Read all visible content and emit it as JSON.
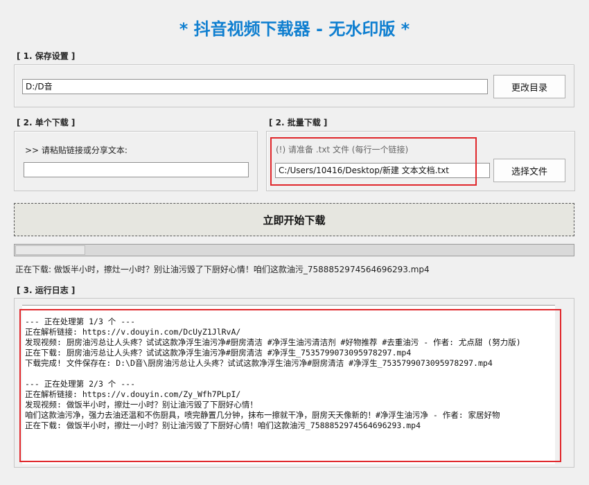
{
  "title": "* 抖音视频下载器 - 无水印版 *",
  "save": {
    "label": "[ 1. 保存设置 ]",
    "path": "D:/D音",
    "change_button": "更改目录"
  },
  "single": {
    "label": "[ 2. 单个下载 ]",
    "prompt": ">> 请粘贴链接或分享文本:",
    "input_value": ""
  },
  "batch": {
    "label": "[ 2. 批量下载 ]",
    "hint": "(!) 请准备 .txt 文件 (每行一个链接)",
    "file_path": "C:/Users/10416/Desktop/新建 文本文档.txt",
    "choose_button": "选择文件"
  },
  "start_button": "立即开始下载",
  "progress": {
    "value": 0.125
  },
  "status": "正在下载: 做饭半小时，擦灶一小时？别让油污毁了下厨好心情！咱们这款油污_7588852974564696293.mp4",
  "log": {
    "label": "[ 3. 运行日志 ]",
    "lines": [
      "--- 正在处理第 1/3 个 ---",
      "正在解析链接: https://v.douyin.com/DcUyZ1JlRvA/",
      "发现视频: 厨房油污总让人头疼？试试这款净浮生油污净#厨房清洁 #净浮生油污清洁剂 #好物推荐 #去重油污 - 作者: 尤点甜 (努力版)",
      "正在下载: 厨房油污总让人头疼？试试这款净浮生油污净#厨房清洁 #净浮生_7535799073095978297.mp4",
      "下载完成! 文件保存在: D:\\D音\\厨房油污总让人头疼？试试这款净浮生油污净#厨房清洁 #净浮生_7535799073095978297.mp4",
      "",
      "--- 正在处理第 2/3 个 ---",
      "正在解析链接: https://v.douyin.com/Zy_Wfh7PLpI/",
      "发现视频: 做饭半小时，擦灶一小时？别让油污毁了下厨好心情！",
      "咱们这款油污净，强力去油还温和不伤厨具，喷完静置几分钟，抹布一擦就干净，厨房天天像新的！#净浮生油污净 - 作者: 家居好物",
      "正在下载: 做饭半小时，擦灶一小时？别让油污毁了下厨好心情！咱们这款油污_7588852974564696293.mp4"
    ]
  },
  "colors": {
    "title": "#0f7fd0",
    "highlight": "#e0262a",
    "background": "#f0f0f0"
  }
}
